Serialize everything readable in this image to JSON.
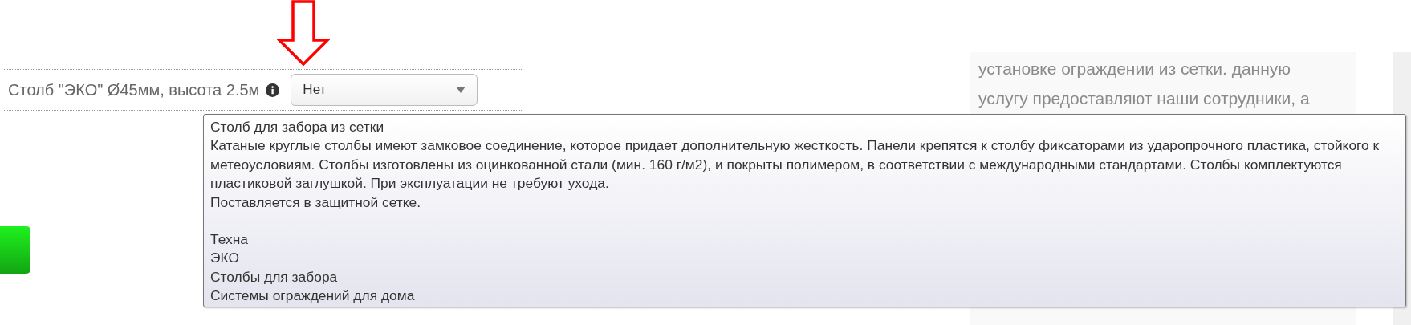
{
  "option": {
    "label": "Столб \"ЭКО\" Ø45мм, высота 2.5м",
    "value": "Нет"
  },
  "side_panel": {
    "lines": [
      "установке ограждении из сетки. данную",
      "услугу предоставляют наши сотрудники, а"
    ]
  },
  "tooltip": {
    "title": "Столб для забора из сетки",
    "description": "Катаные круглые столбы имеют замковое соединение, которое придает дополнительную жесткость. Панели крепятся к столбу фиксаторами из ударопрочного пластика, стойкого к метеоусловиям. Столбы изготовлены из оцинкованной стали (мин. 160 г/м2), и покрыты полимером, в соответствии с международными стандартами. Столбы комплектуются пластиковой заглушкой. При эксплуатации не требуют ухода.",
    "note": "Поставляется в защитной сетке.",
    "tags": [
      "Техна",
      "ЭКО",
      "Столбы для забора",
      "Системы ограждений для дома"
    ]
  }
}
